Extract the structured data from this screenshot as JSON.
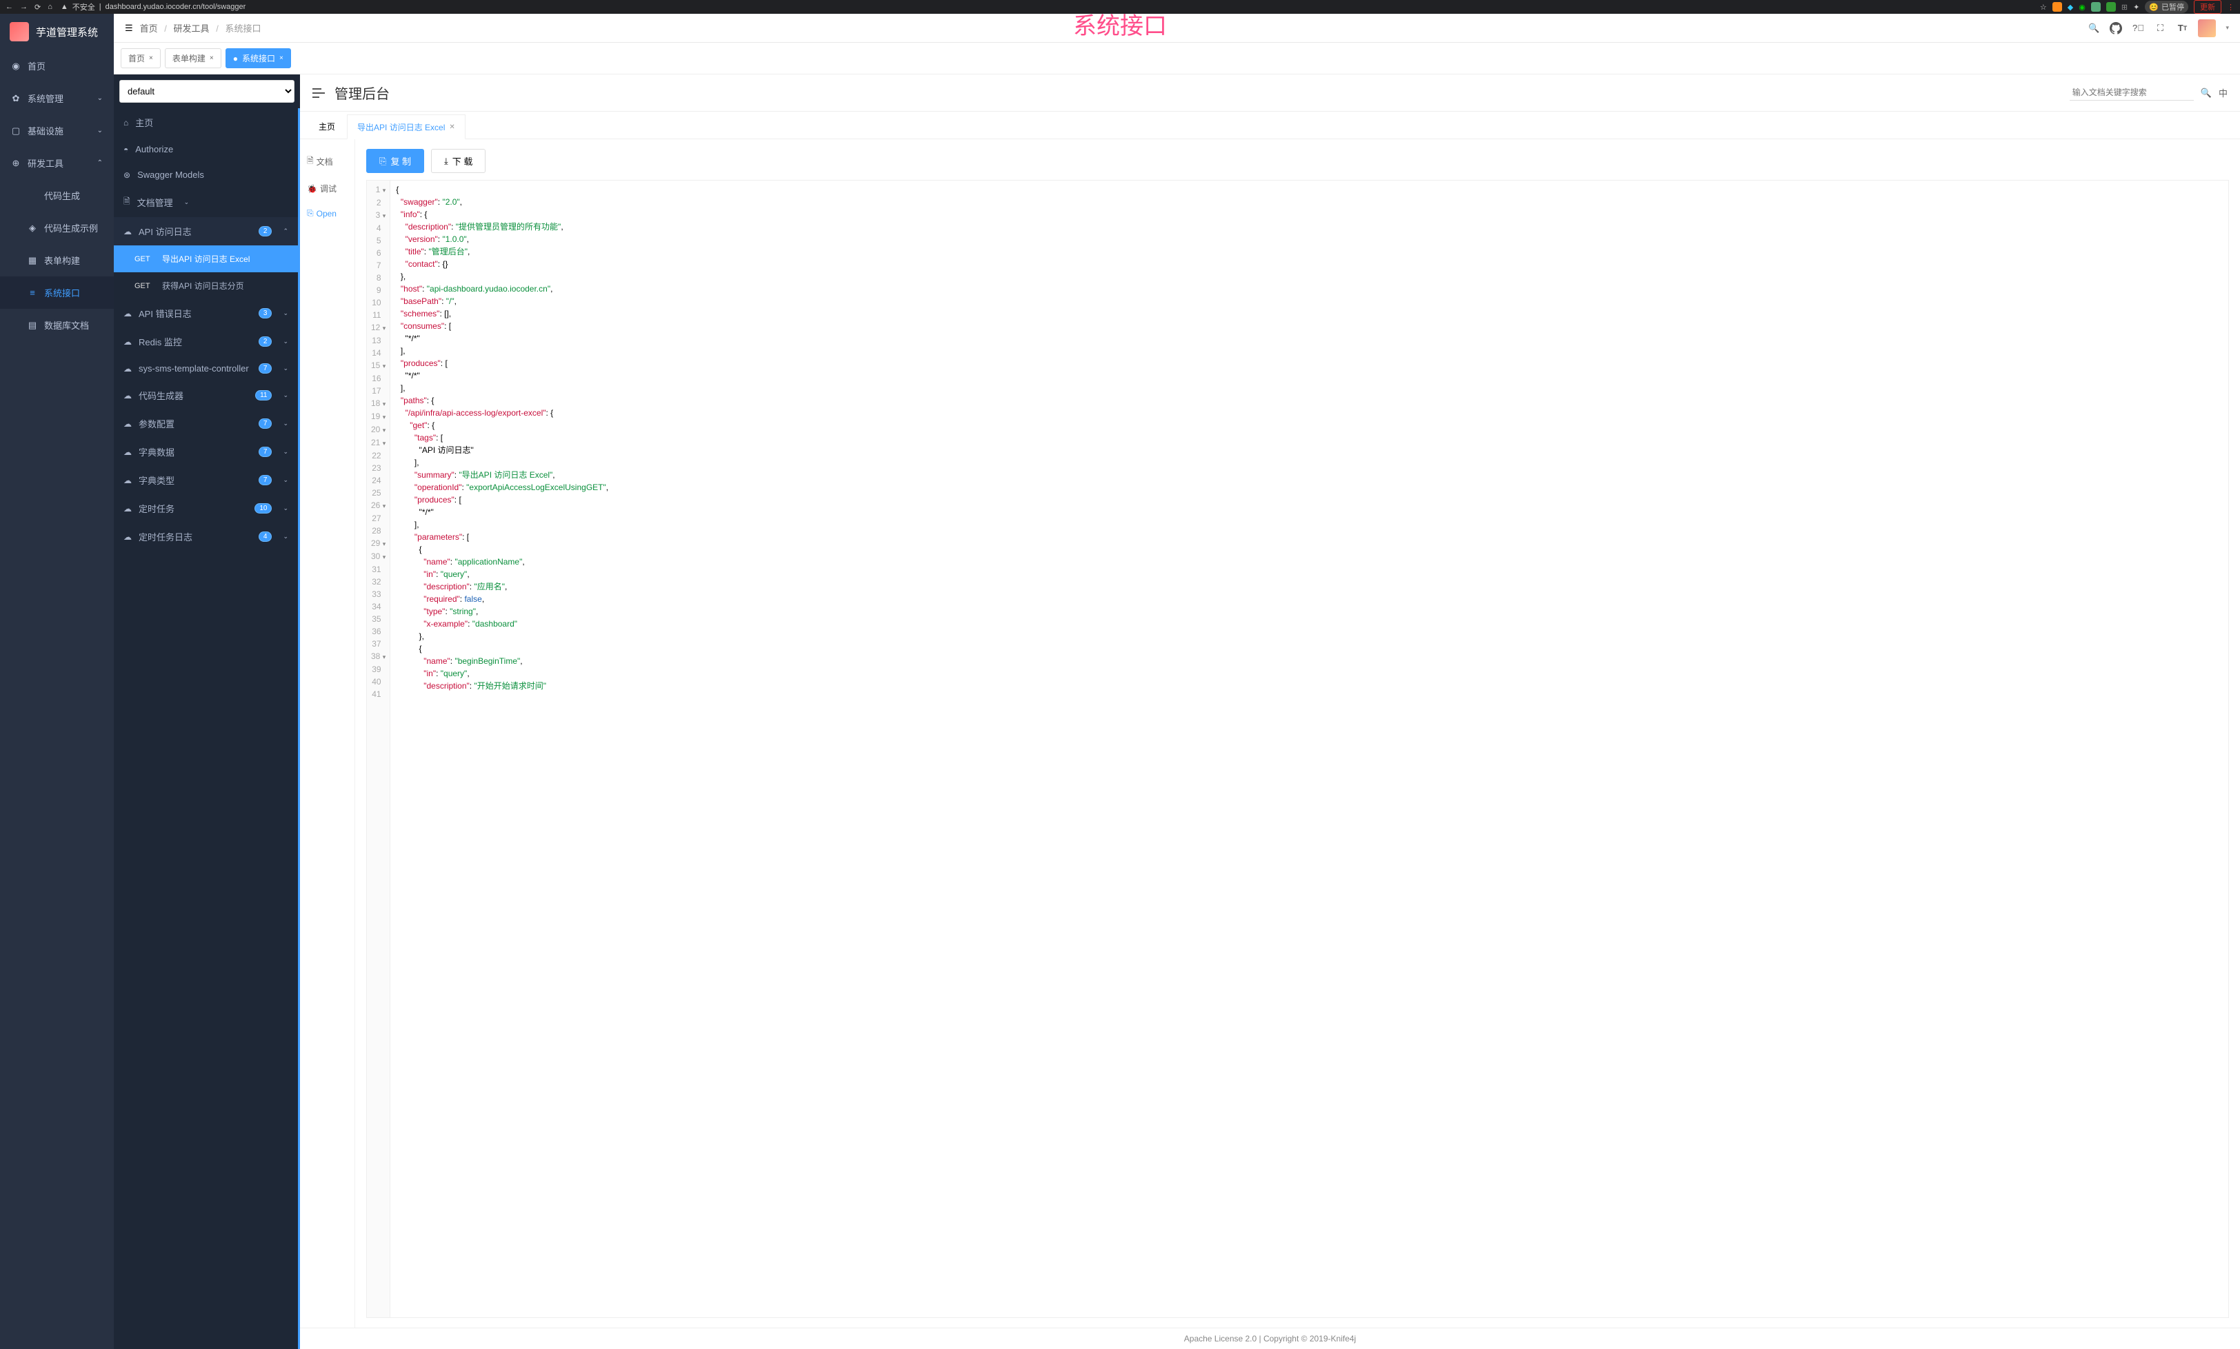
{
  "browser": {
    "insecure": "不安全",
    "url": "dashboard.yudao.iocoder.cn/tool/swagger",
    "paused": "已暂停",
    "update": "更新"
  },
  "overlay": "系统接口",
  "logo_text": "芋道管理系统",
  "crumb": {
    "home": "首页",
    "tools": "研发工具",
    "last": "系统接口"
  },
  "tabs": [
    {
      "label": "首页"
    },
    {
      "label": "表单构建"
    },
    {
      "label": "系统接口",
      "active": true
    }
  ],
  "menu1": [
    {
      "icon": "◉",
      "label": "首页"
    },
    {
      "icon": "✿",
      "label": "系统管理",
      "chev": "⌄"
    },
    {
      "icon": "▢",
      "label": "基础设施",
      "chev": "⌄"
    },
    {
      "icon": "⊕",
      "label": "研发工具",
      "chev": "⌃",
      "open": true
    },
    {
      "icon": "</>",
      "label": "代码生成",
      "sub": true
    },
    {
      "icon": "◈",
      "label": "代码生成示例",
      "sub": true
    },
    {
      "icon": "▦",
      "label": "表单构建",
      "sub": true
    },
    {
      "icon": "≡",
      "label": "系统接口",
      "sub": true,
      "active": true
    },
    {
      "icon": "▤",
      "label": "数据库文档",
      "sub": true
    }
  ],
  "select_default": "default",
  "api_list": [
    {
      "icon": "⌂",
      "label": "主页"
    },
    {
      "icon": "◓",
      "label": "Authorize"
    },
    {
      "icon": "⊛",
      "label": "Swagger Models"
    },
    {
      "icon": "🗎",
      "label": "文档管理",
      "chev": "⌄"
    },
    {
      "icon": "☁",
      "label": "API 访问日志",
      "badge": "2",
      "chev": "⌃",
      "expanded": true
    },
    {
      "endpoint": true,
      "method": "GET",
      "label": "导出API 访问日志 Excel",
      "selected": true
    },
    {
      "endpoint": true,
      "method": "GET",
      "label": "获得API 访问日志分页"
    },
    {
      "icon": "☁",
      "label": "API 错误日志",
      "badge": "3",
      "chev": "⌄"
    },
    {
      "icon": "☁",
      "label": "Redis 监控",
      "badge": "2",
      "chev": "⌄"
    },
    {
      "icon": "☁",
      "label": "sys-sms-template-controller",
      "badge": "7",
      "chev": "⌄"
    },
    {
      "icon": "☁",
      "label": "代码生成器",
      "badge": "11",
      "chev": "⌄"
    },
    {
      "icon": "☁",
      "label": "参数配置",
      "badge": "7",
      "chev": "⌄"
    },
    {
      "icon": "☁",
      "label": "字典数据",
      "badge": "7",
      "chev": "⌄"
    },
    {
      "icon": "☁",
      "label": "字典类型",
      "badge": "7",
      "chev": "⌄"
    },
    {
      "icon": "☁",
      "label": "定时任务",
      "badge": "10",
      "chev": "⌄"
    },
    {
      "icon": "☁",
      "label": "定时任务日志",
      "badge": "4",
      "chev": "⌄"
    }
  ],
  "main_title": "管理后台",
  "search_placeholder": "输入文档关键字搜索",
  "lang": "中",
  "doc_tabs": {
    "home": "主页",
    "current": "导出API 访问日志 Excel"
  },
  "leftcol": {
    "doc": "文档",
    "debug": "调试",
    "open": "Open"
  },
  "btns": {
    "copy": "复 制",
    "download": "下 载"
  },
  "code_lines": [
    "{",
    "  \"swagger\": \"2.0\",",
    "  \"info\": {",
    "    \"description\": \"提供管理员管理的所有功能\",",
    "    \"version\": \"1.0.0\",",
    "    \"title\": \"管理后台\",",
    "    \"contact\": {}",
    "  },",
    "  \"host\": \"api-dashboard.yudao.iocoder.cn\",",
    "  \"basePath\": \"/\",",
    "  \"schemes\": [],",
    "  \"consumes\": [",
    "    \"*/*\"",
    "  ],",
    "  \"produces\": [",
    "    \"*/*\"",
    "  ],",
    "  \"paths\": {",
    "    \"/api/infra/api-access-log/export-excel\": {",
    "      \"get\": {",
    "        \"tags\": [",
    "          \"API 访问日志\"",
    "        ],",
    "        \"summary\": \"导出API 访问日志 Excel\",",
    "        \"operationId\": \"exportApiAccessLogExcelUsingGET\",",
    "        \"produces\": [",
    "          \"*/*\"",
    "        ],",
    "        \"parameters\": [",
    "          {",
    "            \"name\": \"applicationName\",",
    "            \"in\": \"query\",",
    "            \"description\": \"应用名\",",
    "            \"required\": false,",
    "            \"type\": \"string\",",
    "            \"x-example\": \"dashboard\"",
    "          },",
    "          {",
    "            \"name\": \"beginBeginTime\",",
    "            \"in\": \"query\",",
    "            \"description\": \"开始开始请求时间\""
  ],
  "fold_lines": [
    1,
    3,
    12,
    15,
    18,
    19,
    20,
    21,
    26,
    29,
    30,
    38
  ],
  "footer": "Apache License 2.0 | Copyright © 2019-Knife4j"
}
